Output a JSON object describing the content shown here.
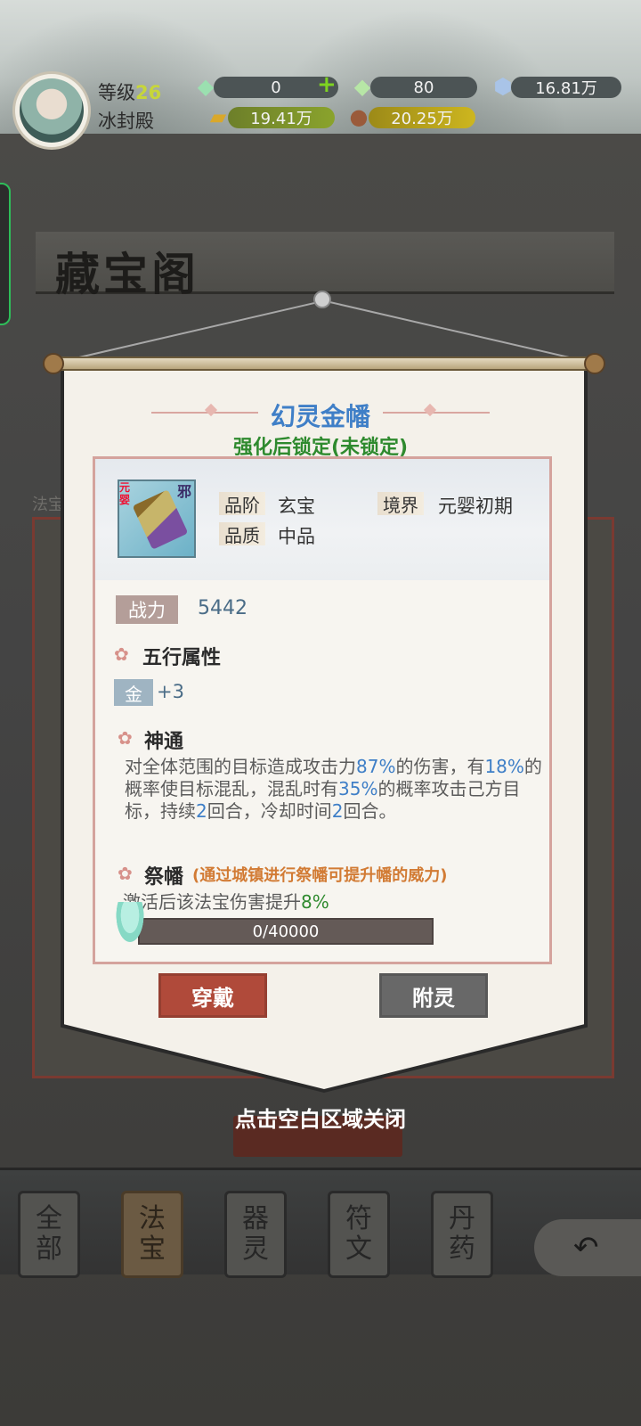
{
  "hud": {
    "level_label": "等级",
    "level_value": "26",
    "hall_name": "冰封殿",
    "resources": {
      "spirit_stone": "0",
      "bound_stone": "80",
      "crystal": "16.81万",
      "gold": "19.41万",
      "wood": "20.25万"
    }
  },
  "background": {
    "title": "藏宝阁",
    "panel_label": "法宝",
    "tabs": [
      {
        "label": "全部",
        "chars": [
          "全",
          "部"
        ]
      },
      {
        "label": "法宝",
        "chars": [
          "法",
          "宝"
        ]
      },
      {
        "label": "器灵",
        "chars": [
          "器",
          "灵"
        ]
      },
      {
        "label": "符文",
        "chars": [
          "符",
          "文"
        ]
      },
      {
        "label": "丹药",
        "chars": [
          "丹",
          "药"
        ]
      }
    ],
    "back_icon": "↶"
  },
  "dialog": {
    "item_name": "幻灵金幡",
    "lock_status": "强化后锁定(未锁定)",
    "thumb": {
      "tag_left": "元婴",
      "tag_right": "邪"
    },
    "attributes": {
      "rank_label": "品阶",
      "rank_value": "玄宝",
      "realm_label": "境界",
      "realm_value": "元婴初期",
      "quality_label": "品质",
      "quality_value": "中品"
    },
    "power_label": "战力",
    "power_value": "5442",
    "five_elements_title": "五行属性",
    "element_name": "金",
    "element_value": "+3",
    "skill_title": "神通",
    "skill_text": {
      "p1": "对全体范围的目标造成攻击力",
      "v1": "87%",
      "p2": "的伤害，有",
      "v2": "18%",
      "p3": "的概率使目标混乱，混乱时有",
      "v3": "35%",
      "p4": "的概率攻击己方目标，持续",
      "v4": "2",
      "p5": "回合，冷却时间",
      "v5": "2",
      "p6": "回合。"
    },
    "ji_title": "祭幡",
    "ji_note": "(通过城镇进行祭幡可提升幡的威力)",
    "ji_desc_prefix": "激活后该法宝伤害提升",
    "ji_desc_value": "8%",
    "progress_text": "0/40000",
    "progress_fraction": 0,
    "wear_button": "穿戴",
    "spirit_button": "附灵",
    "close_hint": "点击空白区域关闭"
  }
}
